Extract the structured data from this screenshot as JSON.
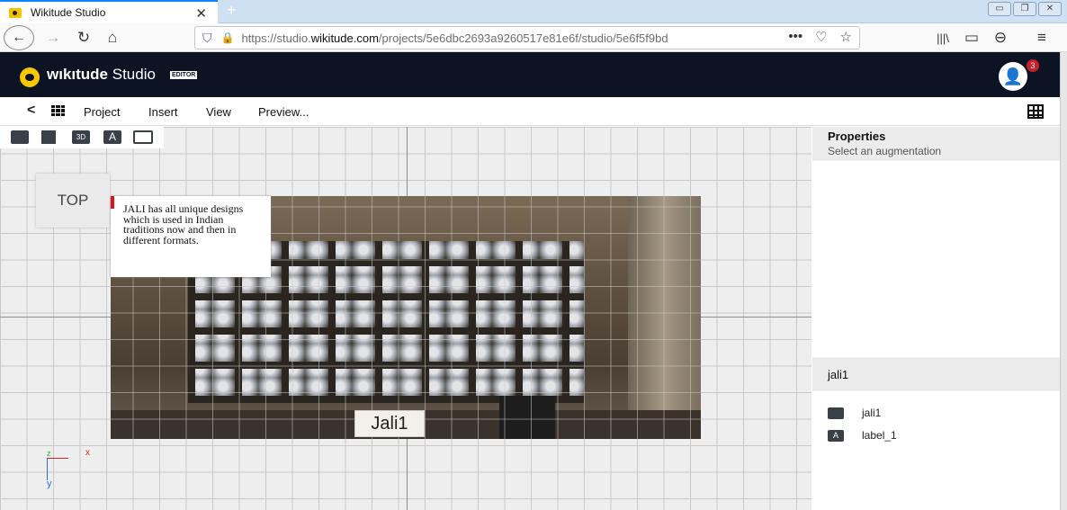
{
  "browser": {
    "tab_title": "Wikitude Studio",
    "tab_close": "✕",
    "new_tab": "+",
    "url_prefix": "https://studio.",
    "url_domain": "wikitude.com",
    "url_path": "/projects/5e6dbc2693a9260517e81e6f/studio/5e6f5f9bd",
    "back": "←",
    "forward": "→",
    "reload": "↻",
    "home": "⌂",
    "page_actions": "•••",
    "library": "|||\\",
    "sidebar": "▭",
    "account": "⊖",
    "menu": "≡",
    "window_buttons": [
      "▭",
      "❐",
      "✕"
    ]
  },
  "app": {
    "brand_bold": "wıkıtude",
    "brand_light": " Studio",
    "editor_badge": "EDITOR",
    "notification_count": "3",
    "user_icon": "👤"
  },
  "menu": {
    "back": "<",
    "items": [
      "Project",
      "Insert",
      "View",
      "Preview..."
    ]
  },
  "canvas": {
    "tools": [
      "image-icon",
      "video-icon",
      "3d-model-icon",
      "text-icon",
      "button-icon"
    ],
    "tool_labels": [
      "",
      "",
      "3D",
      "A",
      ""
    ],
    "view_label": "TOP",
    "text_augmentation": "JALI has all unique designs which is used in Indian traditions now and then in different formats.",
    "image_label": "Jali1",
    "gizmo": {
      "z": "z",
      "x": "x",
      "y": "y"
    }
  },
  "properties": {
    "title": "Properties",
    "subtitle": "Select an augmentation"
  },
  "scene": {
    "title": "jali1",
    "items": [
      {
        "icon": "image-icon",
        "glyph": "",
        "label": "jali1"
      },
      {
        "icon": "text-icon",
        "glyph": "A",
        "label": "label_1"
      }
    ]
  }
}
